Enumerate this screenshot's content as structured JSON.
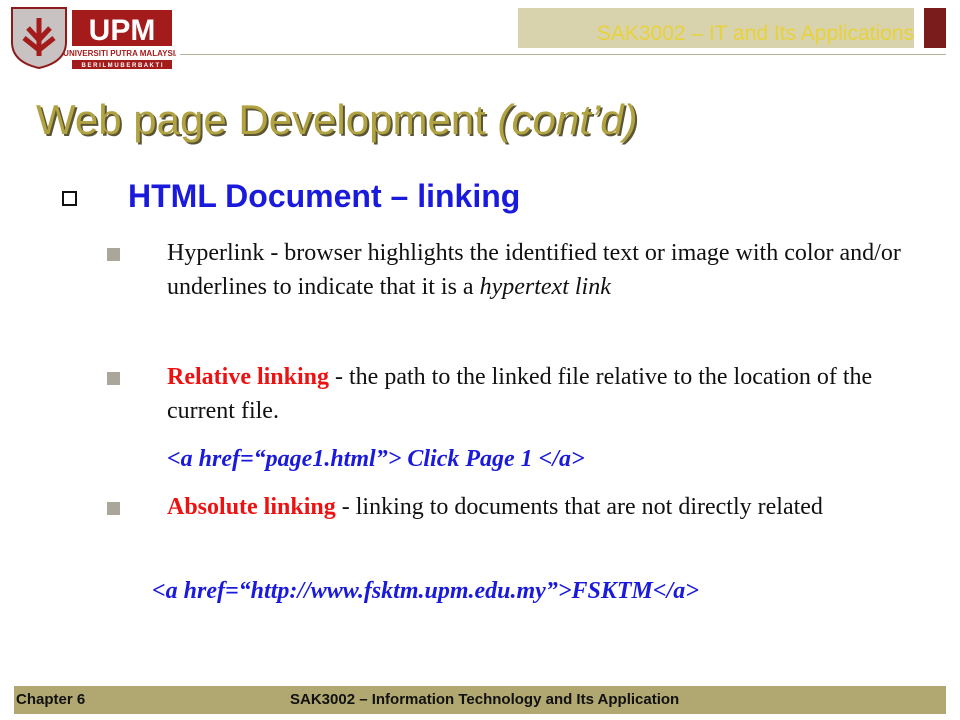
{
  "header": {
    "logo_text": "UPM",
    "logo_subtitle": "UNIVERSITI PUTRA MALAYSIA",
    "logo_tagline": "B E R I L M U   B E R B A K T I",
    "course_title": "SAK3002 – IT and Its Applications"
  },
  "slide": {
    "title": "Web page Development",
    "title_suffix": "(cont’d)",
    "heading": "HTML Document – linking",
    "bullets": [
      {
        "lead": "",
        "text": "Hyperlink - browser highlights the identified text or image with color and/or underlines to indicate that it is a ",
        "italic": "hypertext link"
      },
      {
        "lead": "Relative linking",
        "text": " - the path to the linked file relative to the location of the current file.",
        "code": "<a href=“page1.html”> Click Page 1 </a>"
      },
      {
        "lead": "Absolute linking",
        "text": " - linking to documents that are not directly related",
        "code": "<a href=“http://www.fsktm.upm.edu.my”>FSKTM</a>"
      }
    ]
  },
  "footer": {
    "chapter": "Chapter 6",
    "course": "SAK3002 – Information Technology and Its Application"
  },
  "colors": {
    "title": "#b1a242",
    "heading": "#1a1adc",
    "emphasis": "#ee1111",
    "footer_bg": "#b1a770",
    "header_box": "#d9d3ad",
    "accent": "#7a1c1c"
  },
  "icons": [
    "upm-crest-icon",
    "hollow-square-bullet-icon",
    "square-bullet-icon"
  ]
}
